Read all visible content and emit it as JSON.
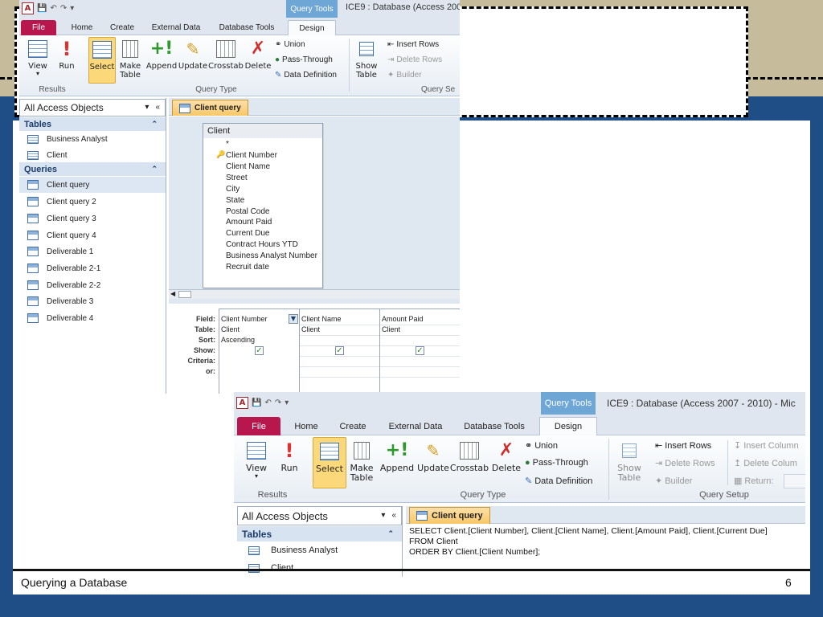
{
  "slide": {
    "footer_left": "Querying a Database",
    "page_number": "6"
  },
  "top_window": {
    "title": "ICE9 : Database (Access 200",
    "context_tab": "Query Tools",
    "tabs": [
      "File",
      "Home",
      "Create",
      "External Data",
      "Database Tools",
      "Design"
    ],
    "ribbon": {
      "view": "View",
      "run": "Run",
      "select": "Select",
      "make_table_1": "Make",
      "make_table_2": "Table",
      "append": "Append",
      "update": "Update",
      "crosstab": "Crosstab",
      "delete": "Delete",
      "union": "Union",
      "pass_through": "Pass-Through",
      "data_definition": "Data Definition",
      "show_table_1": "Show",
      "show_table_2": "Table",
      "insert_rows": "Insert Rows",
      "delete_rows": "Delete Rows",
      "builder": "Builder",
      "group_results": "Results",
      "group_query_type": "Query Type",
      "group_query_setup": "Query Se"
    },
    "nav": {
      "header": "All Access Objects",
      "tables_label": "Tables",
      "tables": [
        "Business Analyst",
        "Client"
      ],
      "queries_label": "Queries",
      "queries": [
        "Client query",
        "Client query 2",
        "Client query 3",
        "Client query 4",
        "Deliverable 1",
        "Deliverable 2-1",
        "Deliverable 2-2",
        "Deliverable 3",
        "Deliverable 4"
      ]
    },
    "doc_tab": "Client query",
    "table_box": {
      "title": "Client",
      "fields": [
        "*",
        "Client Number",
        "Client Name",
        "Street",
        "City",
        "State",
        "Postal Code",
        "Amount Paid",
        "Current Due",
        "Contract Hours YTD",
        "Business Analyst Number",
        "Recruit date"
      ]
    },
    "qbe": {
      "row_labels": [
        "Field:",
        "Table:",
        "Sort:",
        "Show:",
        "Criteria:",
        "or:"
      ],
      "columns": [
        {
          "field": "Client Number",
          "table": "Client",
          "sort": "Ascending"
        },
        {
          "field": "Client Name",
          "table": "Client",
          "sort": ""
        },
        {
          "field": "Amount Paid",
          "table": "Client",
          "sort": ""
        }
      ]
    }
  },
  "bottom_window": {
    "title": "ICE9 : Database (Access 2007 - 2010)  -  Mic",
    "context_tab": "Query Tools",
    "tabs": [
      "File",
      "Home",
      "Create",
      "External Data",
      "Database Tools",
      "Design"
    ],
    "ribbon": {
      "view": "View",
      "run": "Run",
      "select": "Select",
      "make_table_1": "Make",
      "make_table_2": "Table",
      "append": "Append",
      "update": "Update",
      "crosstab": "Crosstab",
      "delete": "Delete",
      "union": "Union",
      "pass_through": "Pass-Through",
      "data_definition": "Data Definition",
      "show_table_1": "Show",
      "show_table_2": "Table",
      "insert_rows": "Insert Rows",
      "delete_rows": "Delete Rows",
      "builder": "Builder",
      "insert_columns": "Insert Column",
      "delete_columns": "Delete Colum",
      "return": "Return:",
      "group_results": "Results",
      "group_query_type": "Query Type",
      "group_query_setup": "Query Setup"
    },
    "nav": {
      "header": "All Access Objects",
      "tables_label": "Tables",
      "tables": [
        "Business Analyst",
        "Client"
      ]
    },
    "doc_tab": "Client query",
    "sql": {
      "line1": "SELECT Client.[Client Number], Client.[Client Name], Client.[Amount Paid], Client.[Current Due]",
      "line2": "FROM Client",
      "line3": "ORDER BY Client.[Client Number];"
    }
  }
}
